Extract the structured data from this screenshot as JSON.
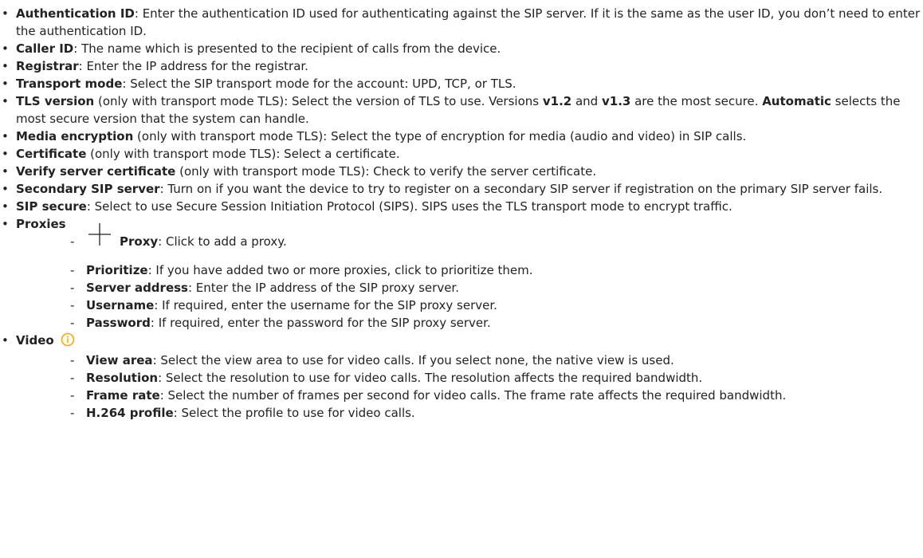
{
  "items": [
    {
      "term": "Authentication ID",
      "text": ": Enter the authentication ID used for authenticating against the SIP server. If it is the same as the user ID, you don’t need to enter the authentication ID."
    },
    {
      "term": "Caller ID",
      "text": ": The name which is presented to the recipient of calls from the device."
    },
    {
      "term": "Registrar",
      "text": ": Enter the IP address for the registrar."
    },
    {
      "term": "Transport mode",
      "text": ": Select the SIP transport mode for the account: UPD, TCP, or TLS."
    },
    {
      "term": "TLS version",
      "t1": " (only with transport mode TLS): Select the version of TLS to use. Versions ",
      "v12": "v1.2",
      "and": " and ",
      "v13": "v1.3",
      "t2": " are the most secure. ",
      "auto": "Automatic",
      "t3": " selects the most secure version that the system can handle."
    },
    {
      "term": "Media encryption",
      "text": " (only with transport mode TLS): Select the type of encryption for media (audio and video) in SIP calls."
    },
    {
      "term": "Certificate",
      "text": " (only with transport mode TLS): Select a certificate."
    },
    {
      "term": "Verify server certificate",
      "text": " (only with transport mode TLS): Check to verify the server certificate."
    },
    {
      "term": "Secondary SIP server",
      "text": ": Turn on if you want the device to try to register on a secondary SIP server if registration on the primary SIP server fails."
    },
    {
      "term": "SIP secure",
      "text": ": Select to use Secure Session Initiation Protocol (SIPS). SIPS uses the TLS transport mode to encrypt traffic."
    }
  ],
  "proxies": {
    "heading": "Proxies",
    "items": [
      {
        "term": "Proxy",
        "text": ": Click to add a proxy."
      },
      {
        "term": "Prioritize",
        "text": ": If you have added two or more proxies, click to prioritize them."
      },
      {
        "term": "Server address",
        "text": ": Enter the IP address of the SIP proxy server."
      },
      {
        "term": "Username",
        "text": ": If required, enter the username for the SIP proxy server."
      },
      {
        "term": "Password",
        "text": ": If required, enter the password for the SIP proxy server."
      }
    ]
  },
  "video": {
    "heading": "Video",
    "items": [
      {
        "term": "View area",
        "text": ": Select the view area to use for video calls. If you select none, the native view is used."
      },
      {
        "term": "Resolution",
        "text": ": Select the resolution to use for video calls. The resolution affects the required bandwidth."
      },
      {
        "term": "Frame rate",
        "text": ": Select the number of frames per second for video calls. The frame rate affects the required bandwidth."
      },
      {
        "term": "H.264 profile",
        "text": ": Select the profile to use for video calls."
      }
    ]
  },
  "icons": {
    "add": "plus-icon",
    "info": "info-icon"
  },
  "colors": {
    "info_icon": "#f5a623"
  }
}
